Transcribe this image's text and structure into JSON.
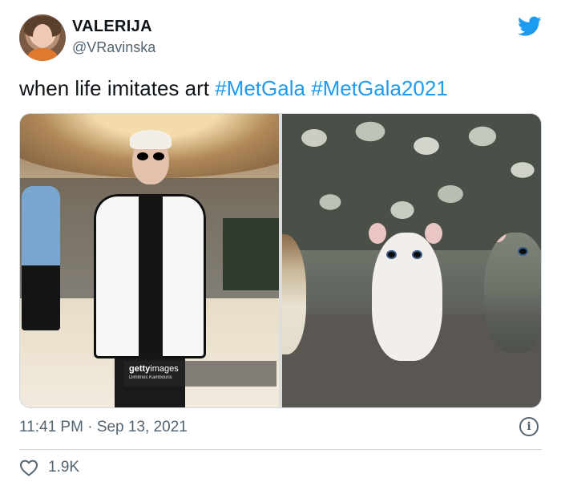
{
  "author": {
    "display_name": "VALERIJA",
    "handle": "@VRavinska"
  },
  "tweet": {
    "text": "when life imitates art",
    "hashtags": [
      "#MetGala",
      "#MetGala2021"
    ]
  },
  "media": {
    "left_watermark_brand_bold": "getty",
    "left_watermark_brand": "images",
    "left_watermark_credit": "Dimitrios Kambouris"
  },
  "meta": {
    "time": "11:41 PM",
    "separator": "·",
    "date": "Sep 13, 2021"
  },
  "engagement": {
    "likes": "1.9K"
  },
  "icons": {
    "brand": "twitter-bird-icon",
    "info": "info-icon",
    "like": "heart-icon"
  },
  "colors": {
    "accent": "#1d9bf0",
    "text_primary": "#0f1419",
    "text_secondary": "#536471",
    "border": "#cfd9de"
  }
}
